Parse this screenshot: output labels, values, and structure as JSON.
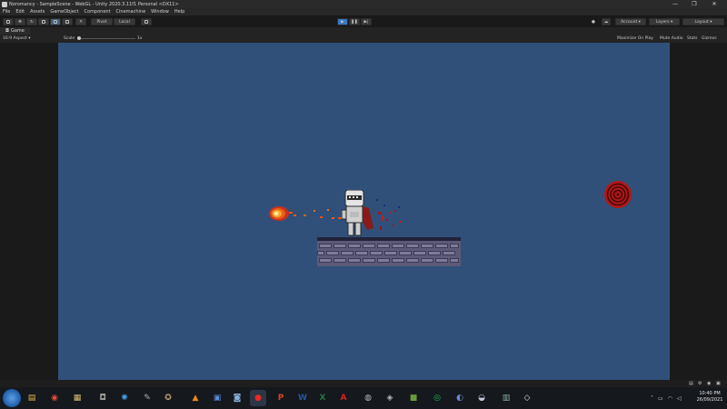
{
  "window": {
    "title": "Noromancy - SampleScene - WebGL - Unity 2020.3.11f1 Personal <DX11>",
    "controls": [
      "—",
      "❐",
      "✕"
    ]
  },
  "menu": [
    "File",
    "Edit",
    "Assets",
    "GameObject",
    "Component",
    "Cinemachine",
    "Window",
    "Help"
  ],
  "toolbar": {
    "pivot": "Pivot",
    "local": "Local",
    "account": "Account",
    "layers": "Layers",
    "layout": "Layout"
  },
  "tabs": [
    {
      "label": "Game",
      "icon": "game-controller-icon"
    }
  ],
  "game_toolbar": {
    "aspect": "16:9 Aspect",
    "scale_label": "Scale",
    "scale_value": "1x",
    "maximize": "Maximize On Play",
    "mute": "Mute Audio",
    "stats": "Stats",
    "gizmos": "Gizmos"
  },
  "scene_colors": {
    "background": "#30507a",
    "fireball": "#e8501a",
    "portal": "#b01818",
    "knight_armor": "#d8d8d8",
    "cape": "#8a1a1a"
  },
  "taskbar": {
    "apps": [
      {
        "name": "file-explorer-icon",
        "glyph": "▤",
        "color": "#e8b84a"
      },
      {
        "name": "chrome-icon",
        "glyph": "◉",
        "color": "#e84a3a"
      },
      {
        "name": "explorer-folder-icon",
        "glyph": "▦",
        "color": "#d8c070"
      },
      {
        "name": "game-controller-app-icon",
        "glyph": "◘",
        "color": "#9a9a9a"
      },
      {
        "name": "asterisk-app-icon",
        "glyph": "✺",
        "color": "#4aa0e8"
      },
      {
        "name": "brush-icon",
        "glyph": "✎",
        "color": "#b0b0b0"
      },
      {
        "name": "gimp-icon",
        "glyph": "✪",
        "color": "#c0a070"
      },
      {
        "name": "vlc-icon",
        "glyph": "▲",
        "color": "#e88a1a"
      },
      {
        "name": "file-manager-icon",
        "glyph": "▣",
        "color": "#5a8ad8"
      },
      {
        "name": "photo-viewer-icon",
        "glyph": "◙",
        "color": "#8ab0d8"
      },
      {
        "name": "record-app-icon",
        "glyph": "●",
        "color": "#e82a2a"
      },
      {
        "name": "powerpoint-icon",
        "glyph": "P",
        "color": "#d24726"
      },
      {
        "name": "word-icon",
        "glyph": "W",
        "color": "#2b579a"
      },
      {
        "name": "excel-icon",
        "glyph": "X",
        "color": "#217346"
      },
      {
        "name": "acrobat-icon",
        "glyph": "A",
        "color": "#e02020"
      },
      {
        "name": "unity-hub-icon",
        "glyph": "◍",
        "color": "#b8b8b8"
      },
      {
        "name": "unity-icon",
        "glyph": "◈",
        "color": "#b8b8b8"
      },
      {
        "name": "minecraft-icon",
        "glyph": "■",
        "color": "#6a9a3a"
      },
      {
        "name": "spotify-icon",
        "glyph": "◎",
        "color": "#1db954"
      },
      {
        "name": "discord-icon",
        "glyph": "◐",
        "color": "#7289da"
      },
      {
        "name": "steam-icon",
        "glyph": "◒",
        "color": "#c0c8d8"
      },
      {
        "name": "task-view-icon",
        "glyph": "▥",
        "color": "#8ab0a0"
      },
      {
        "name": "unity-editor-icon",
        "glyph": "◇",
        "color": "#e0e0e0"
      }
    ],
    "time": "10:40 PM",
    "date": "26/09/2021"
  }
}
